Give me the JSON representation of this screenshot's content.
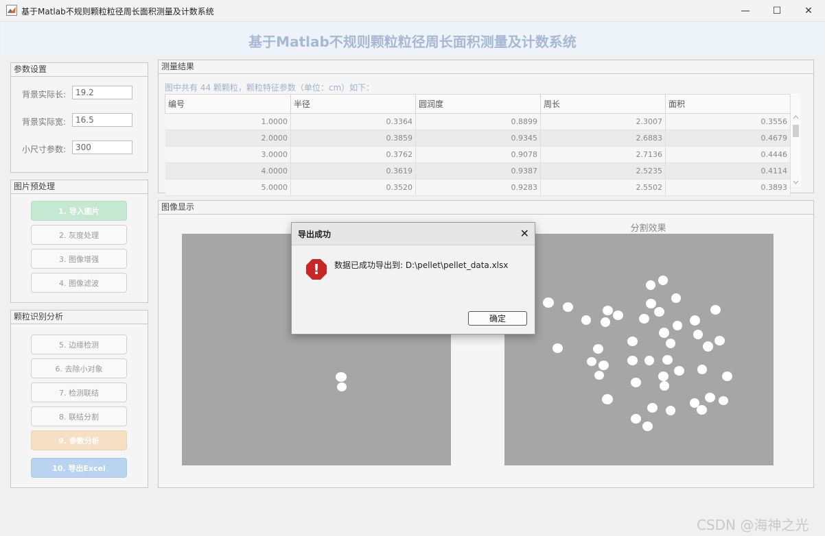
{
  "window": {
    "title": "基于Matlab不规则颗粒粒径周长面积测量及计数系统",
    "controls": {
      "minimize": "—",
      "maximize": "☐",
      "close": "✕"
    }
  },
  "app_title": "基于Matlab不规则颗粒粒径周长面积测量及计数系统",
  "params": {
    "title": "参数设置",
    "bg_width_label": "背景实际长:",
    "bg_width_value": "19.2",
    "bg_height_label": "背景实际宽:",
    "bg_height_value": "16.5",
    "min_size_label": "小尺寸参数:",
    "min_size_value": "300"
  },
  "preprocess": {
    "title": "图片预处理",
    "buttons": [
      "1. 导入图片",
      "2. 灰度处理",
      "3. 图像增强",
      "4. 图像滤波"
    ]
  },
  "analysis": {
    "title": "颗粒识别分析",
    "buttons": [
      "5. 边缘检测",
      "6. 去除小对象",
      "7. 检测联结",
      "8. 联结分割",
      "9. 参数分析",
      "10. 导出Excel"
    ]
  },
  "results": {
    "title": "测量结果",
    "summary": "图中共有  44  颗颗粒，颗粒特征参数（单位：cm）如下：",
    "columns": [
      "编号",
      "半径",
      "圆润度",
      "周长",
      "面积"
    ],
    "rows": [
      [
        "1.0000",
        "0.3364",
        "0.8899",
        "2.3007",
        "0.3556"
      ],
      [
        "2.0000",
        "0.3859",
        "0.9345",
        "2.6883",
        "0.4679"
      ],
      [
        "3.0000",
        "0.3762",
        "0.9078",
        "2.7136",
        "0.4446"
      ],
      [
        "4.0000",
        "0.3619",
        "0.9387",
        "2.5235",
        "0.4114"
      ],
      [
        "5.0000",
        "0.3520",
        "0.9283",
        "2.5502",
        "0.3893"
      ]
    ]
  },
  "display": {
    "title": "图像显示",
    "right_caption": "分割效果"
  },
  "dialog": {
    "title": "导出成功",
    "message": "数据已成功导出到: D:\\pellet\\pellet_data.xlsx",
    "ok": "确定",
    "close": "✕",
    "icon_glyph": "!"
  },
  "watermark": "CSDN @海神之光",
  "colors": {
    "title_accent": "#a8b8d4",
    "btn_green": "#c4e8d2",
    "btn_orange": "#f7dfc3",
    "btn_blue": "#b9d4ee",
    "error_red": "#c62828",
    "image_bg": "#a6a6a6"
  }
}
